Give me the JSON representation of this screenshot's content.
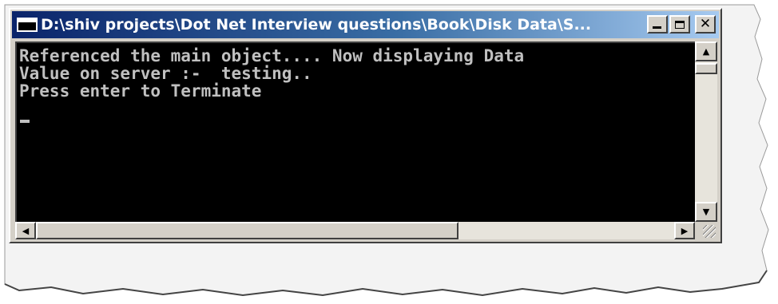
{
  "window": {
    "title": "D:\\shiv projects\\Dot Net Interview questions\\Book\\Disk Data\\S...",
    "controls": [
      "minimize",
      "maximize",
      "close"
    ]
  },
  "console": {
    "lines": [
      "Referenced the main object.... Now displaying Data",
      "Value on server :-  testing..",
      "Press enter to Terminate"
    ],
    "text_color": "#c0c0c0",
    "background_color": "#000000"
  },
  "scrollbars": {
    "vertical": {
      "up_icon": "arrow-up-icon",
      "down_icon": "arrow-down-icon"
    },
    "horizontal": {
      "left_icon": "arrow-left-icon",
      "right_icon": "arrow-right-icon"
    }
  },
  "colors": {
    "titlebar_start": "#0a246a",
    "titlebar_end": "#a6caf0",
    "chrome": "#d4d0c8"
  }
}
